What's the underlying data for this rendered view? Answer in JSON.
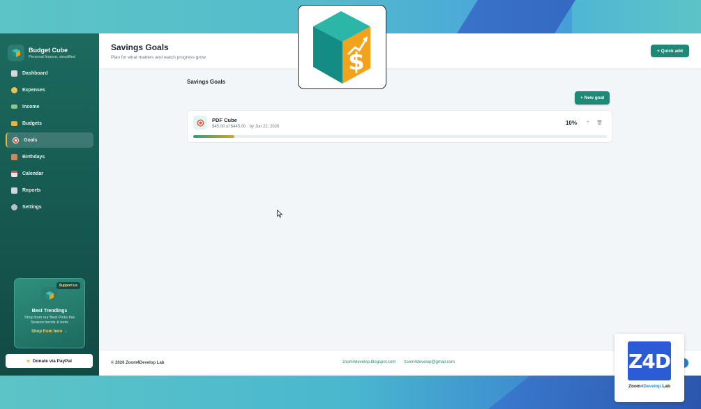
{
  "brand": {
    "name": "Budget Cube",
    "tagline": "Personal finance, simplified"
  },
  "sidebar": {
    "items": [
      {
        "label": "Dashboard",
        "icon": "chart-icon",
        "color": "#d8d8d8"
      },
      {
        "label": "Expenses",
        "icon": "coins-icon",
        "color": "#e7c25a"
      },
      {
        "label": "Income",
        "icon": "money-icon",
        "color": "#8fc98a"
      },
      {
        "label": "Budgets",
        "icon": "folder-icon",
        "color": "#e8b340"
      },
      {
        "label": "Goals",
        "icon": "target-icon",
        "color": "#e2584a",
        "active": true
      },
      {
        "label": "Birthdays",
        "icon": "cake-icon",
        "color": "#c9885e"
      },
      {
        "label": "Calendar",
        "icon": "calendar-icon",
        "color": "#e6e6e6"
      },
      {
        "label": "Reports",
        "icon": "reports-icon",
        "color": "#cfd8dc"
      },
      {
        "label": "Settings",
        "icon": "gear-icon",
        "color": "#b8c2c7"
      }
    ],
    "promo": {
      "badge": "Support us",
      "title": "Best Trendings",
      "text": "Shop from our Best Picks this Season trends & tools",
      "link": "Shop from here →"
    },
    "donate_label": "Donate via PayPal"
  },
  "header": {
    "title": "Savings Goals",
    "subtitle": "Plan for what matters and watch progress grow.",
    "quick_add_label": "+ Quick add"
  },
  "content": {
    "section_title": "Savings Goals",
    "new_goal_label": "+ New goal",
    "goals": [
      {
        "name": "PDF Cube",
        "meta": "$45.00 of $445.00 · by Jun 22, 2026",
        "percent_label": "10%",
        "progress": 0.1,
        "add_symbol": "+",
        "delete_symbol": "🗑"
      }
    ]
  },
  "footer": {
    "copyright": "© 2026 Zoom4Develop Lab",
    "links": [
      "zoom4develop.blogspot.com",
      "zoom4develop@gmail.com"
    ],
    "separator": "·"
  },
  "watermark": {
    "mark": "Z4D",
    "label_prefix": "Zoom",
    "label_highlight": "4Develop",
    "label_suffix": " Lab"
  },
  "colors": {
    "accent": "#1d8a78",
    "sidebar": "#1c6a5f",
    "active_border": "#f3b52c"
  }
}
